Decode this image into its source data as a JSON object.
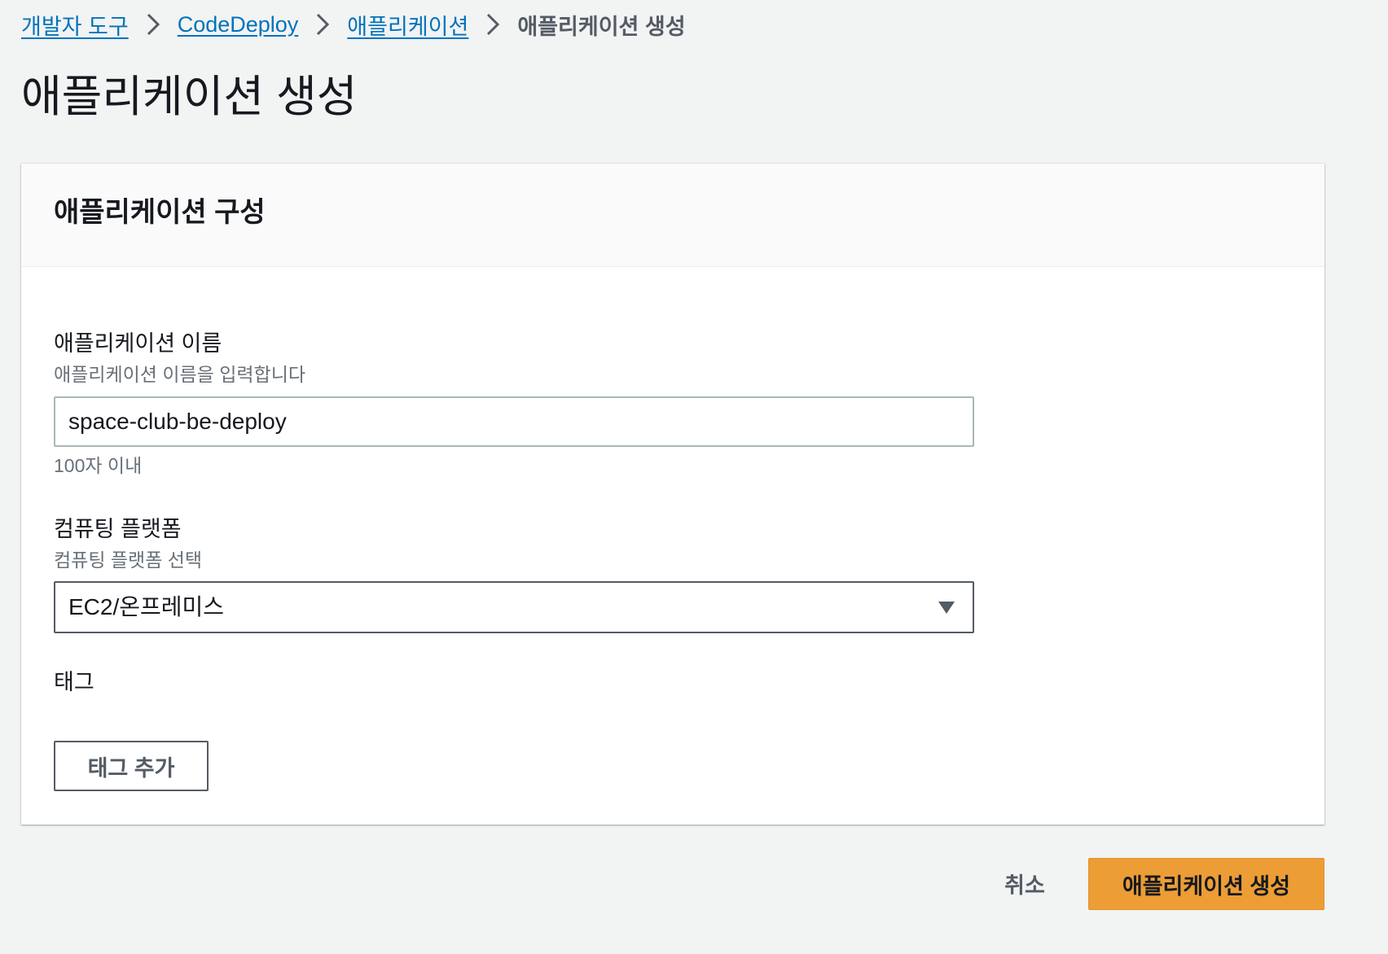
{
  "breadcrumb": {
    "items": [
      {
        "label": "개발자 도구"
      },
      {
        "label": "CodeDeploy"
      },
      {
        "label": "애플리케이션"
      }
    ],
    "current": "애플리케이션 생성"
  },
  "page": {
    "title": "애플리케이션 생성"
  },
  "panel": {
    "title": "애플리케이션 구성",
    "app_name": {
      "label": "애플리케이션 이름",
      "description": "애플리케이션 이름을 입력합니다",
      "value": "space-club-be-deploy",
      "constraint": "100자 이내"
    },
    "compute_platform": {
      "label": "컴퓨팅 플랫폼",
      "description": "컴퓨팅 플랫폼 선택",
      "selected": "EC2/온프레미스"
    },
    "tags": {
      "label": "태그",
      "add_button": "태그 추가"
    }
  },
  "actions": {
    "cancel": "취소",
    "create": "애플리케이션 생성"
  },
  "colors": {
    "link": "#0073bb",
    "primary_button": "#ec9d35",
    "background": "#f2f3f3"
  }
}
